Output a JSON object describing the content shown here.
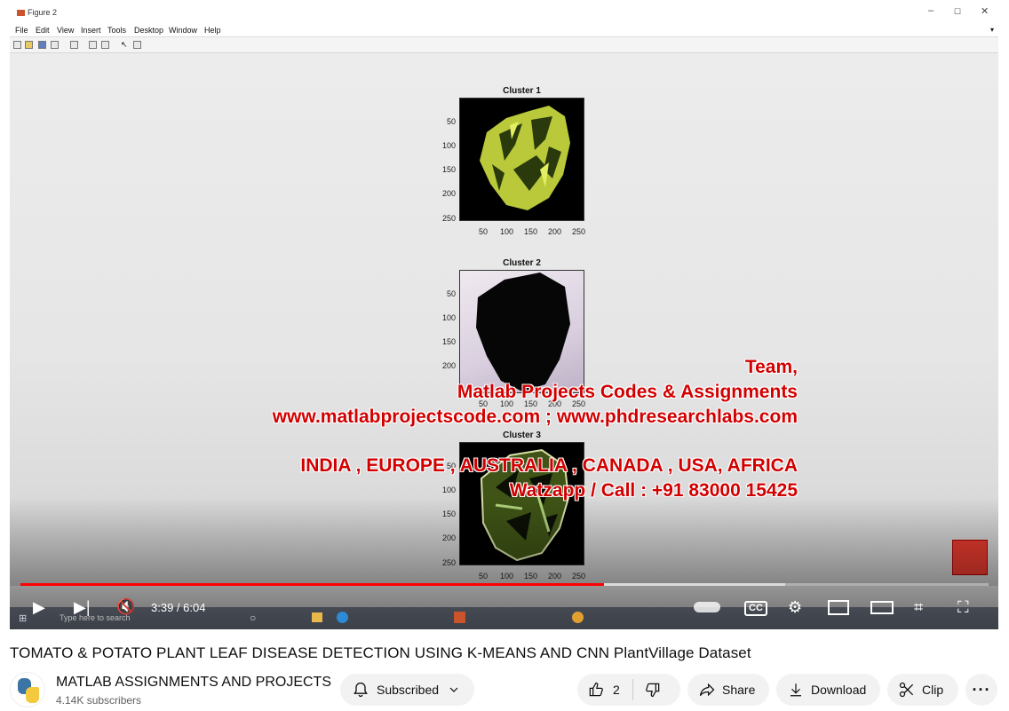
{
  "window": {
    "title": "Figure 2",
    "controls": {
      "minimize": "–",
      "maximize": "☐",
      "close": "✕"
    }
  },
  "menu": [
    "File",
    "Edit",
    "View",
    "Insert",
    "Tools",
    "Desktop",
    "Window",
    "Help"
  ],
  "figure": {
    "subplots": [
      {
        "title": "Cluster 1",
        "yticks": [
          "50",
          "100",
          "150",
          "200",
          "250"
        ],
        "xticks": [
          "50",
          "100",
          "150",
          "200",
          "250"
        ]
      },
      {
        "title": "Cluster 2",
        "yticks": [
          "50",
          "100",
          "150",
          "200"
        ],
        "xticks": [
          "50",
          "100",
          "150",
          "200",
          "250"
        ]
      },
      {
        "title": "Cluster 3",
        "yticks": [
          "50",
          "100",
          "150",
          "200",
          "250"
        ],
        "xticks": [
          "50",
          "100",
          "150",
          "200",
          "250"
        ]
      }
    ]
  },
  "overlay": {
    "line1": "Team,",
    "line2": "Matlab Projects Codes & Assignments",
    "line3": "www.matlabprojectscode.com ; www.phdresearchlabs.com",
    "line4": "INDIA , EUROPE , AUSTRALIA , CANADA , USA, AFRICA",
    "line5": "Watzapp / Call : +91 83000 15425"
  },
  "taskbar": {
    "search_placeholder": "Type here to search"
  },
  "player": {
    "current_time": "3:39",
    "duration": "6:04",
    "time_display": "3:39 / 6:04",
    "progress_fraction": 0.603,
    "buffered_fraction": 0.79,
    "progress_color": "#ff0000",
    "cc_label": "CC"
  },
  "video": {
    "title": "TOMATO & POTATO PLANT LEAF DISEASE DETECTION USING K-MEANS AND CNN PlantVillage Dataset"
  },
  "channel": {
    "name": "MATLAB ASSIGNMENTS AND PROJECTS",
    "subscribers": "4.14K subscribers"
  },
  "actions": {
    "subscribed_label": "Subscribed",
    "like_count": "2",
    "share_label": "Share",
    "download_label": "Download",
    "clip_label": "Clip"
  }
}
